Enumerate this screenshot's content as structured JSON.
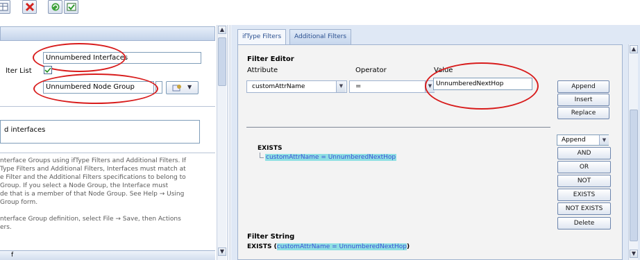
{
  "left": {
    "name_value": "Unnumbered Interfaces",
    "filter_list_label": "lter List",
    "node_group_value": "Unnumbered Node Group",
    "description_value": "d interfaces",
    "help_lines": [
      "nterface Groups using ifType Filters and Additional Filters. If",
      "Type Filters and Additional Filters, Interfaces must match at",
      "e Filter and the Additional Filters specifications to belong to",
      "Group. If you select a Node Group, the Interface must",
      "de that is a member of that Node Group. See Help → Using",
      "Group form.",
      "",
      "nterface Group definition, select File → Save, then Actions",
      "ers."
    ],
    "bottom_text": "f"
  },
  "tabs": [
    {
      "label": "ifType Filters"
    },
    {
      "label": "Additional Filters"
    }
  ],
  "filter_editor": {
    "title": "Filter Editor",
    "attribute_label": "Attribute",
    "operator_label": "Operator",
    "value_label": "Value",
    "attribute_value": "customAttrName",
    "operator_value": "=",
    "value_value": "UnnumberedNextHop"
  },
  "buttons_top": {
    "append": "Append",
    "insert": "Insert",
    "replace": "Replace"
  },
  "tree": {
    "root": "EXISTS",
    "child": "customAttrName = UnnumberedNextHop"
  },
  "buttons_side": {
    "mode_select": "Append",
    "and": "AND",
    "or": "OR",
    "not": "NOT",
    "exists": "EXISTS",
    "not_exists": "NOT EXISTS",
    "delete": "Delete"
  },
  "filter_string": {
    "label": "Filter String",
    "prefix": "EXISTS (",
    "highlight": "customAttrName = UnnumberedNextHop",
    "suffix": ")"
  },
  "colors": {
    "annotation_red": "#d81c1c",
    "highlight_blue": "#3b4fd6",
    "highlight_bg": "#8fe0e3"
  }
}
